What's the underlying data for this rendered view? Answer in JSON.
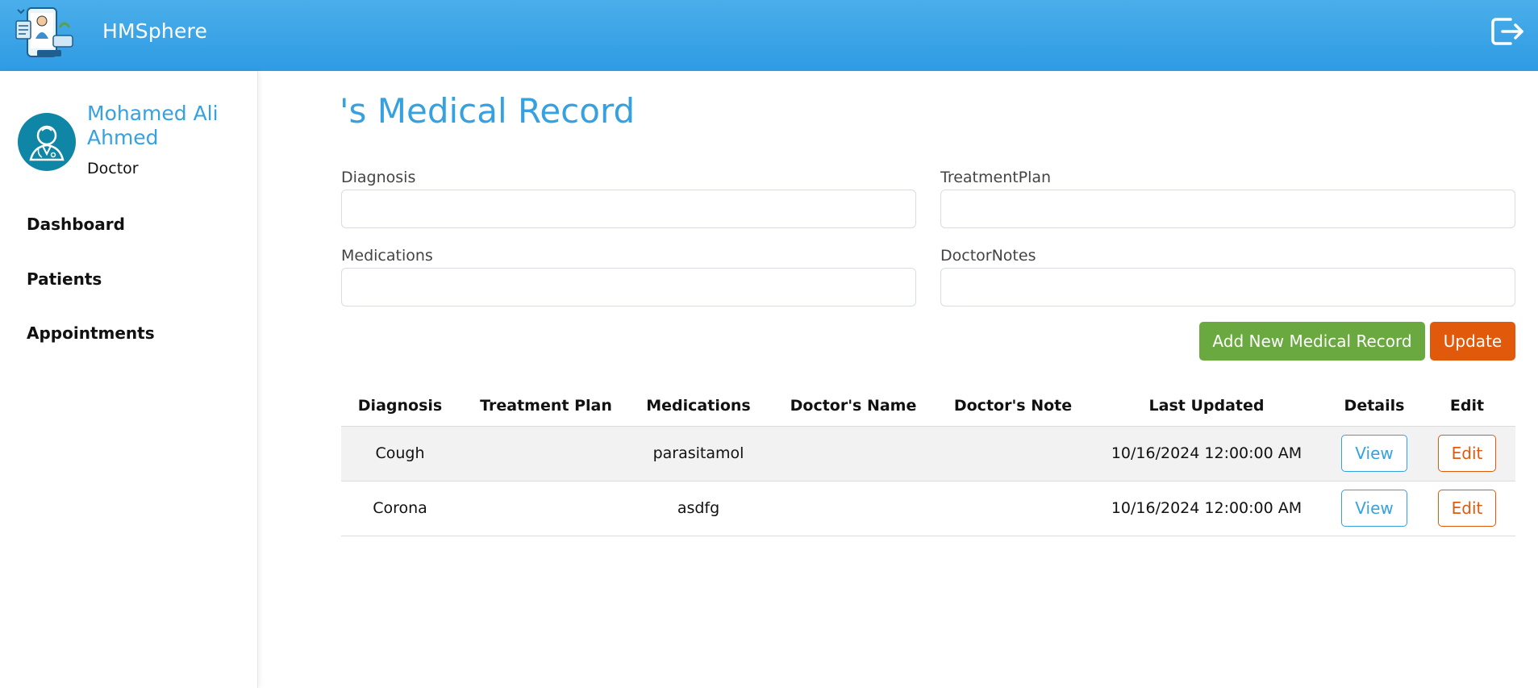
{
  "app": {
    "title": "HMSphere"
  },
  "user": {
    "name": "Mohamed Ali Ahmed",
    "role": "Doctor"
  },
  "sidebar": {
    "items": [
      {
        "label": "Dashboard"
      },
      {
        "label": "Patients"
      },
      {
        "label": "Appointments"
      }
    ]
  },
  "main": {
    "title": "'s Medical Record",
    "form": {
      "diagnosis_label": "Diagnosis",
      "diagnosis_value": "",
      "treatment_label": "TreatmentPlan",
      "treatment_value": "",
      "medications_label": "Medications",
      "medications_value": "",
      "notes_label": "DoctorNotes",
      "notes_value": ""
    },
    "buttons": {
      "add": "Add New Medical Record",
      "update": "Update"
    },
    "table": {
      "headers": [
        "Diagnosis",
        "Treatment Plan",
        "Medications",
        "Doctor's Name",
        "Doctor's Note",
        "Last Updated",
        "Details",
        "Edit"
      ],
      "rows": [
        {
          "diagnosis": "Cough",
          "treatment": "",
          "medications": "parasitamol",
          "doctor": "",
          "note": "",
          "updated": "10/16/2024 12:00:00 AM",
          "details": "View",
          "edit": "Edit"
        },
        {
          "diagnosis": "Corona",
          "treatment": "",
          "medications": "asdfg",
          "doctor": "",
          "note": "",
          "updated": "10/16/2024 12:00:00 AM",
          "details": "View",
          "edit": "Edit"
        }
      ]
    }
  },
  "colors": {
    "header_blue": "#2f9be3",
    "accent_blue": "#36a1e0",
    "green": "#6aa840",
    "orange": "#e15a0c",
    "avatar_teal": "#0f86a6"
  },
  "icons": {
    "logo": "medical-app-logo-icon",
    "logout": "logout-icon",
    "avatar": "doctor-avatar-icon"
  }
}
